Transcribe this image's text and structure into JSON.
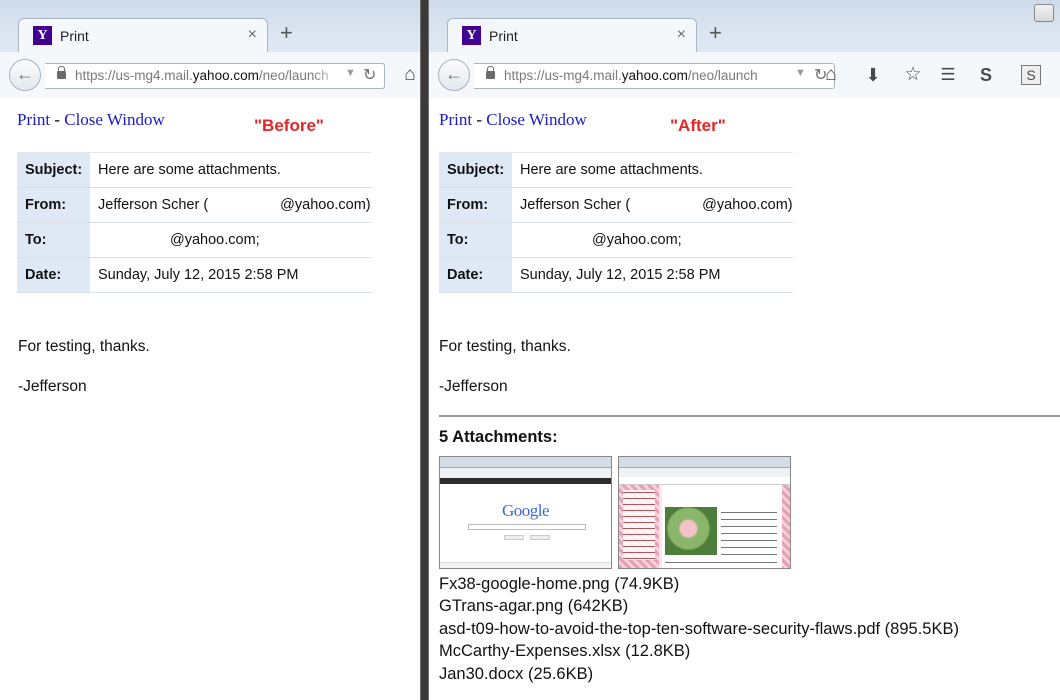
{
  "browser": {
    "tab_title": "Print",
    "favicon": "Y",
    "url_prefix": "https://us-mg4.mail.",
    "url_domain": "yahoo.com",
    "url_suffix": "/neo/launch",
    "new_tab_symbol": "+",
    "close_symbol": "×"
  },
  "page": {
    "print_link": "Print",
    "separator": " - ",
    "close_window_link": "Close Window"
  },
  "labels": {
    "before": "\"Before\"",
    "after": "\"After\""
  },
  "email": {
    "subject_label": "Subject:",
    "subject": "Here are some attachments.",
    "from_label": "From:",
    "from_name": "Jefferson Scher (",
    "from_domain": "@yahoo.com)",
    "to_label": "To:",
    "to_value": "@yahoo.com;",
    "date_label": "Date:",
    "date": "Sunday, July 12, 2015 2:58 PM",
    "body_line1": "For testing, thanks.",
    "body_line2": "-Jefferson"
  },
  "attachments": {
    "heading": "5 Attachments:",
    "thumb1_brand": "Google",
    "items": [
      "Fx38-google-home.png (74.9KB)",
      "GTrans-agar.png (642KB)",
      "asd-t09-how-to-avoid-the-top-ten-software-security-flaws.pdf (895.5KB)",
      "McCarthy-Expenses.xlsx (12.8KB)",
      "Jan30.docx (25.6KB)"
    ]
  },
  "colors": {
    "label_red": "#e32626",
    "link_blue": "#1a1acb",
    "header_key_bg": "#dfe9f6",
    "yahoo_purple": "#410093"
  }
}
